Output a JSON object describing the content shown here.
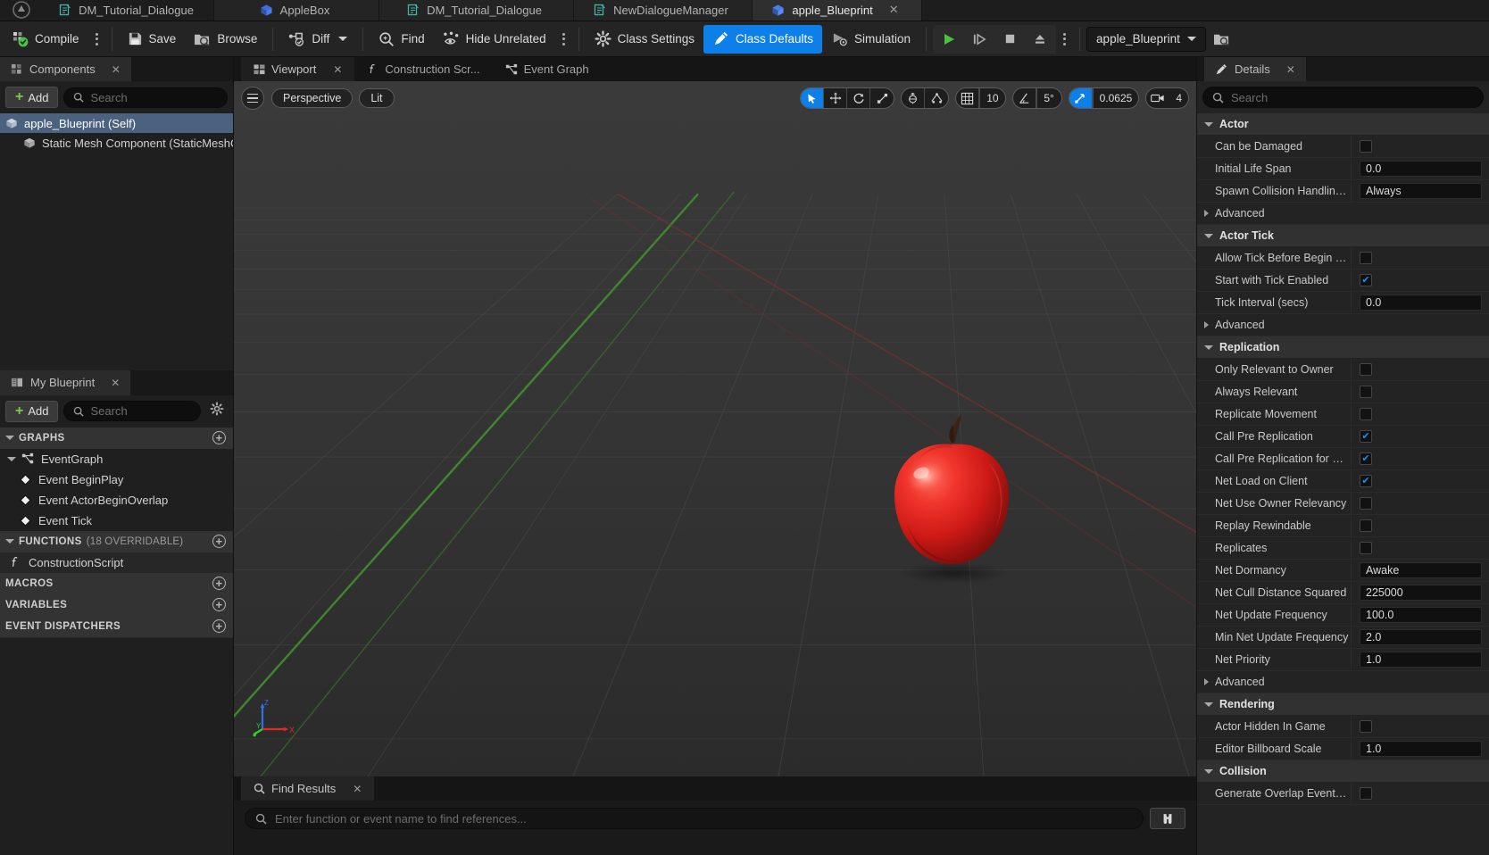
{
  "window_tabs": [
    {
      "label": "DM_Tutorial_Dialogue",
      "icon": "blueprint-icon",
      "active": false
    },
    {
      "label": "AppleBox",
      "icon": "cube-icon",
      "active": false
    },
    {
      "label": "DM_Tutorial_Dialogue",
      "icon": "blueprint-icon",
      "active": false
    },
    {
      "label": "NewDialogueManager",
      "icon": "blueprint-icon",
      "active": false
    },
    {
      "label": "apple_Blueprint",
      "icon": "cube-icon",
      "active": true,
      "close": "✕"
    }
  ],
  "toolbar": {
    "compile": "Compile",
    "save": "Save",
    "browse": "Browse",
    "diff": "Diff",
    "find": "Find",
    "hide_unrelated": "Hide Unrelated",
    "class_settings": "Class Settings",
    "class_defaults": "Class Defaults",
    "simulation": "Simulation",
    "blueprint_selector": "apple_Blueprint",
    "accent_color": "#0c7fe8"
  },
  "components_panel": {
    "tab_label": "Components",
    "tab_close": "✕",
    "add_label": "Add",
    "search_placeholder": "Search",
    "items": [
      {
        "label": "apple_Blueprint (Self)",
        "selected": true,
        "indent": false
      },
      {
        "label": "Static Mesh Component (StaticMeshCo",
        "selected": false,
        "indent": true
      }
    ]
  },
  "my_blueprint_panel": {
    "tab_label": "My Blueprint",
    "tab_close": "✕",
    "add_label": "Add",
    "search_placeholder": "Search",
    "sections": [
      {
        "title": "GRAPHS",
        "subtitle": "",
        "items": [
          {
            "label": "EventGraph",
            "level": 1,
            "icon": "graph-icon"
          },
          {
            "label": "Event BeginPlay",
            "level": 2,
            "icon": "event-node-icon"
          },
          {
            "label": "Event ActorBeginOverlap",
            "level": 2,
            "icon": "event-node-icon"
          },
          {
            "label": "Event Tick",
            "level": 2,
            "icon": "event-node-icon"
          }
        ]
      },
      {
        "title": "FUNCTIONS",
        "subtitle": "(18 OVERRIDABLE)",
        "items": [
          {
            "label": "ConstructionScript",
            "level": 1,
            "icon": "function-icon"
          }
        ]
      },
      {
        "title": "MACROS",
        "subtitle": "",
        "items": []
      },
      {
        "title": "VARIABLES",
        "subtitle": "",
        "items": []
      },
      {
        "title": "EVENT DISPATCHERS",
        "subtitle": "",
        "items": []
      }
    ]
  },
  "viewport": {
    "tabs": [
      {
        "label": "Viewport",
        "icon": "viewport-icon",
        "active": true,
        "close": "✕"
      },
      {
        "label": "Construction Scr...",
        "icon": "function-icon",
        "active": false
      },
      {
        "label": "Event Graph",
        "icon": "graph-icon",
        "active": false
      }
    ],
    "view_mode": "Perspective",
    "lighting_mode": "Lit",
    "grid_snap_value": "10",
    "angle_snap_value": "5°",
    "scale_snap_value": "0.0625",
    "camera_speed": "4",
    "transform_tools": [
      {
        "name": "select-tool",
        "active": true
      },
      {
        "name": "move-tool",
        "active": false
      },
      {
        "name": "rotate-tool",
        "active": false
      },
      {
        "name": "scale-tool",
        "active": false
      }
    ],
    "coord_tools": [
      {
        "name": "world-space-toggle",
        "active": false
      },
      {
        "name": "surface-snap-toggle",
        "active": false
      }
    ]
  },
  "find_results": {
    "tab_label": "Find Results",
    "tab_close": "✕",
    "search_placeholder": "Enter function or event name to find references...",
    "find_button_icon": "binoculars-icon"
  },
  "details_panel": {
    "tab_label": "Details",
    "tab_close": "✕",
    "search_placeholder": "Search",
    "categories": [
      {
        "name": "Actor",
        "expanded": true,
        "rows": [
          {
            "label": "Can be Damaged",
            "type": "checkbox",
            "checked": false
          },
          {
            "label": "Initial Life Span",
            "type": "number",
            "value": "0.0"
          },
          {
            "label": "Spawn Collision Handling Met...",
            "type": "combo",
            "value": "Always"
          },
          {
            "label": "Advanced",
            "type": "advanced"
          }
        ]
      },
      {
        "name": "Actor Tick",
        "expanded": true,
        "rows": [
          {
            "label": "Allow Tick Before Begin Play",
            "type": "checkbox",
            "checked": false
          },
          {
            "label": "Start with Tick Enabled",
            "type": "checkbox",
            "checked": true
          },
          {
            "label": "Tick Interval (secs)",
            "type": "number",
            "value": "0.0"
          },
          {
            "label": "Advanced",
            "type": "advanced"
          }
        ]
      },
      {
        "name": "Replication",
        "expanded": true,
        "rows": [
          {
            "label": "Only Relevant to Owner",
            "type": "checkbox",
            "checked": false
          },
          {
            "label": "Always Relevant",
            "type": "checkbox",
            "checked": false
          },
          {
            "label": "Replicate Movement",
            "type": "checkbox",
            "checked": false
          },
          {
            "label": "Call Pre Replication",
            "type": "checkbox",
            "checked": true
          },
          {
            "label": "Call Pre Replication for Replay",
            "type": "checkbox",
            "checked": true
          },
          {
            "label": "Net Load on Client",
            "type": "checkbox",
            "checked": true
          },
          {
            "label": "Net Use Owner Relevancy",
            "type": "checkbox",
            "checked": false
          },
          {
            "label": "Replay Rewindable",
            "type": "checkbox",
            "checked": false
          },
          {
            "label": "Replicates",
            "type": "checkbox",
            "checked": false
          },
          {
            "label": "Net Dormancy",
            "type": "combo",
            "value": "Awake"
          },
          {
            "label": "Net Cull Distance Squared",
            "type": "number",
            "value": "225000"
          },
          {
            "label": "Net Update Frequency",
            "type": "number",
            "value": "100.0"
          },
          {
            "label": "Min Net Update Frequency",
            "type": "number",
            "value": "2.0"
          },
          {
            "label": "Net Priority",
            "type": "number",
            "value": "1.0"
          },
          {
            "label": "Advanced",
            "type": "advanced"
          }
        ]
      },
      {
        "name": "Rendering",
        "expanded": true,
        "rows": [
          {
            "label": "Actor Hidden In Game",
            "type": "checkbox",
            "checked": false
          },
          {
            "label": "Editor Billboard Scale",
            "type": "number",
            "value": "1.0"
          }
        ]
      },
      {
        "name": "Collision",
        "expanded": true,
        "rows": [
          {
            "label": "Generate Overlap Events Durin...",
            "type": "checkbox",
            "checked": false
          }
        ]
      }
    ]
  }
}
